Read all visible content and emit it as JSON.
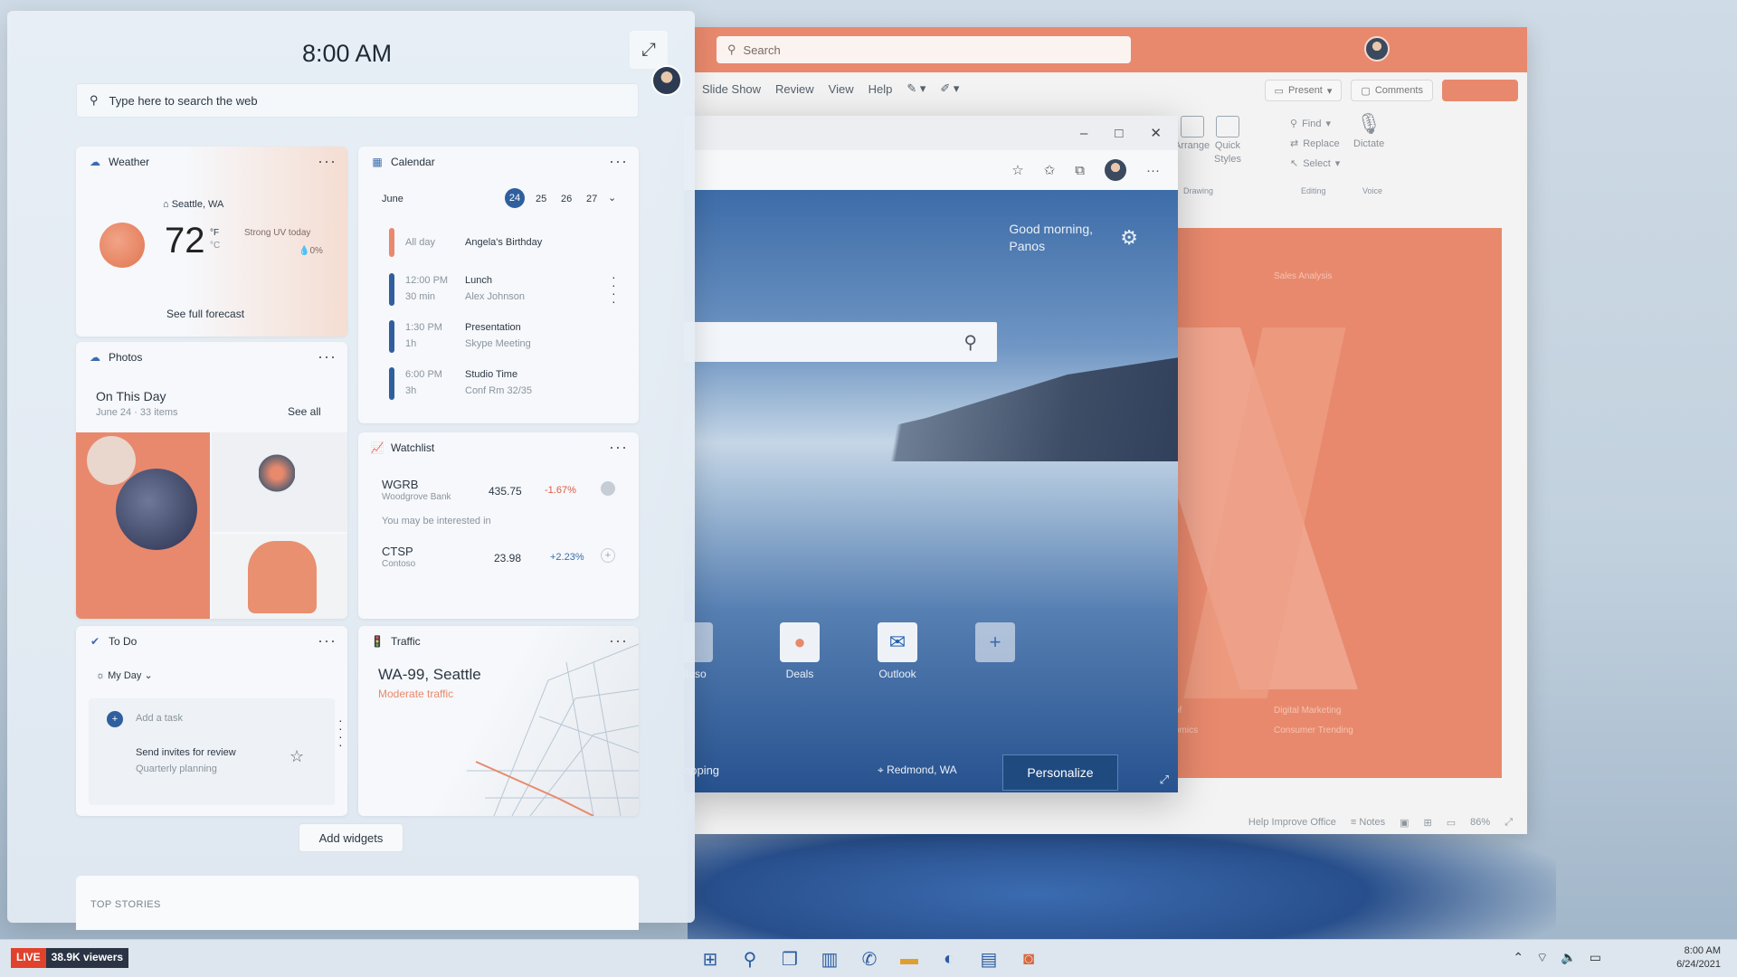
{
  "ppt": {
    "search_placeholder": "Search",
    "menu": [
      "Slide Show",
      "Review",
      "View",
      "Help"
    ],
    "present_label": "Present",
    "comments_label": "Comments",
    "ribbon": {
      "arrange": "Arrange",
      "quick_styles_1": "Quick",
      "quick_styles_2": "Styles",
      "find": "Find",
      "replace": "Replace",
      "select": "Select",
      "dictate": "Dictate",
      "group_drawing": "Drawing",
      "group_editing": "Editing",
      "group_voice": "Voice"
    },
    "slide": {
      "title": "Sales Analysis",
      "line_left_1": "of",
      "line_left_2": "omics",
      "line_right_1": "Digital Marketing",
      "line_right_2": "Consumer Trending"
    },
    "status": {
      "help": "Help Improve Office",
      "notes": "Notes",
      "zoom": "86%"
    }
  },
  "edge": {
    "greeting_line1": "Good morning,",
    "greeting_line2": "Panos",
    "tiles": [
      {
        "label": "ntoso",
        "icon": "contoso-icon"
      },
      {
        "label": "Deals",
        "icon": "deals-icon"
      },
      {
        "label": "Outlook",
        "icon": "outlook-icon"
      },
      {
        "label": "",
        "icon": "add-icon"
      }
    ],
    "bottom_left": "opping",
    "location": "Redmond, WA",
    "personalize": "Personalize"
  },
  "widgets": {
    "time": "8:00 AM",
    "search_placeholder": "Type here to search the web",
    "weather": {
      "title": "Weather",
      "location": "Seattle, WA",
      "temp": "72",
      "unit_f": "°F",
      "unit_c": "°C",
      "condition": "Strong UV today",
      "precip": "0%",
      "link": "See full forecast"
    },
    "calendar": {
      "title": "Calendar",
      "month": "June",
      "days": [
        "24",
        "25",
        "26",
        "27"
      ],
      "events": [
        {
          "time": "All day",
          "dur": "",
          "title": "Angela's Birthday",
          "sub": ""
        },
        {
          "time": "12:00 PM",
          "dur": "30 min",
          "title": "Lunch",
          "sub": "Alex Johnson"
        },
        {
          "time": "1:30 PM",
          "dur": "1h",
          "title": "Presentation",
          "sub": "Skype Meeting"
        },
        {
          "time": "6:00 PM",
          "dur": "3h",
          "title": "Studio Time",
          "sub": "Conf Rm 32/35"
        }
      ]
    },
    "photos": {
      "title": "Photos",
      "heading": "On This Day",
      "sub": "June 24 · 33 items",
      "see_all": "See all"
    },
    "watchlist": {
      "title": "Watchlist",
      "stocks": [
        {
          "ticker": "WGRB",
          "name": "Woodgrove Bank",
          "price": "435.75",
          "change": "-1.67%"
        },
        {
          "ticker": "CTSP",
          "name": "Contoso",
          "price": "23.98",
          "change": "+2.23%"
        }
      ],
      "suggest": "You may be interested in"
    },
    "todo": {
      "title": "To Do",
      "list": "My Day",
      "add_task": "Add a task",
      "task_title": "Send invites for review",
      "task_sub": "Quarterly planning"
    },
    "traffic": {
      "title": "Traffic",
      "road": "WA-99, Seattle",
      "status": "Moderate traffic"
    },
    "add_widgets": "Add widgets",
    "top_stories": "TOP STORIES"
  },
  "taskbar": {
    "live": "LIVE",
    "viewers": "38.9K viewers",
    "time": "8:00 AM",
    "date": "6/24/2021"
  },
  "colors": {
    "accent_orange": "#e8896d",
    "accent_blue": "#2f5f9e",
    "negative": "#e0583f",
    "positive": "#3b6bb0"
  }
}
